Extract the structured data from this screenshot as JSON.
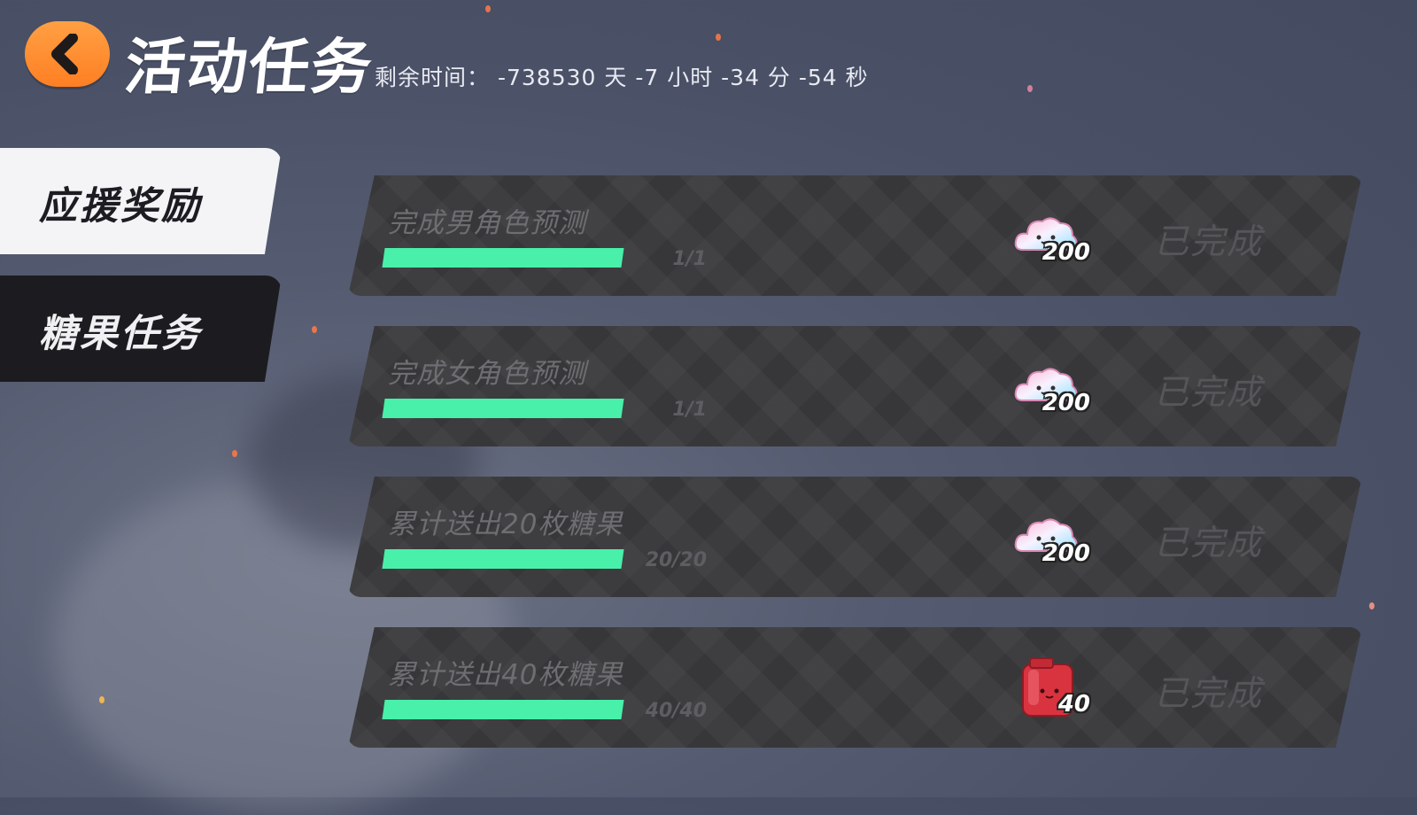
{
  "header": {
    "title": "活动任务",
    "timer_label": "剩余时间：",
    "timer_value": "-738530 天 -7 小时 -34 分 -54 秒"
  },
  "tabs": [
    {
      "label": "应援奖励",
      "active": true
    },
    {
      "label": "糖果任务",
      "active": false
    }
  ],
  "tasks": [
    {
      "name": "完成男角色预测",
      "progress": "1/1",
      "progress_fraction": 1.0,
      "reward_icon": "rainbow-cloud-icon",
      "reward_amount": "200",
      "status": "已完成"
    },
    {
      "name": "完成女角色预测",
      "progress": "1/1",
      "progress_fraction": 1.0,
      "reward_icon": "rainbow-cloud-icon",
      "reward_amount": "200",
      "status": "已完成"
    },
    {
      "name": "累计送出20枚糖果",
      "progress": "20/20",
      "progress_fraction": 1.0,
      "reward_icon": "rainbow-cloud-icon",
      "reward_amount": "200",
      "status": "已完成"
    },
    {
      "name": "累计送出40枚糖果",
      "progress": "40/40",
      "progress_fraction": 1.0,
      "reward_icon": "red-jar-icon",
      "reward_amount": "40",
      "status": "已完成"
    }
  ],
  "colors": {
    "accent_orange": "#ff8a2a",
    "progress_green": "#48f0a9",
    "card_bg": "#3a3a3d"
  }
}
